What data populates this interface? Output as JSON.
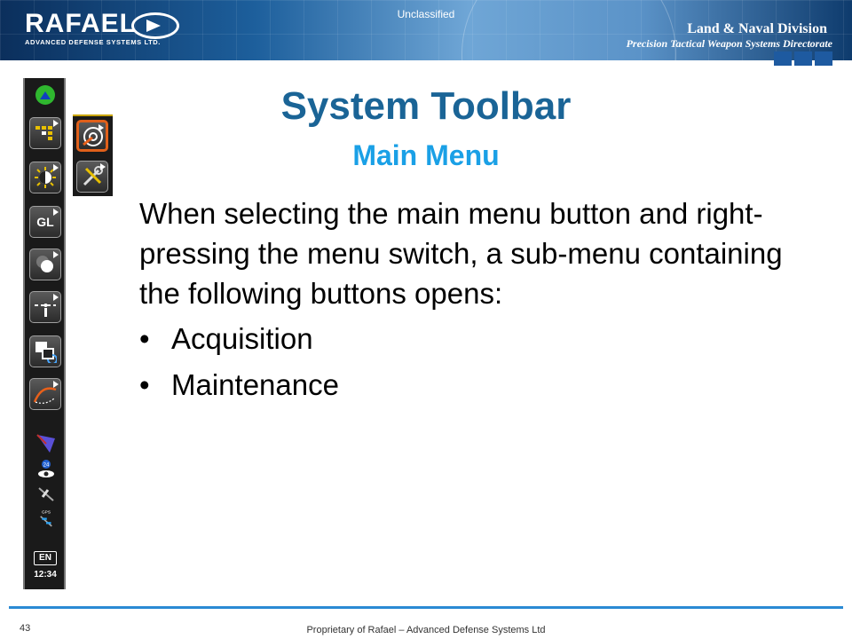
{
  "header": {
    "logo_text": "RAFAEL",
    "logo_subtitle": "ADVANCED DEFENSE SYSTEMS LTD.",
    "classification": "Unclassified",
    "division": "Land & Naval Division",
    "directorate": "Precision Tactical Weapon Systems Directorate"
  },
  "slide": {
    "title": "System Toolbar",
    "subtitle": "Main Menu",
    "body": "When selecting the main menu button and right-pressing the menu switch, a sub-menu containing the following buttons opens:",
    "bullets": [
      "Acquisition",
      "Maintenance"
    ],
    "bullet_glyph": "•"
  },
  "toolbar": {
    "buttons": [
      {
        "icon": "menu-grid-icon"
      },
      {
        "icon": "brightness-icon"
      },
      {
        "label": "GL",
        "icon": "gl-icon"
      },
      {
        "icon": "circles-icon"
      },
      {
        "icon": "crosshair-marker-icon"
      },
      {
        "icon": "window-refresh-icon"
      },
      {
        "icon": "trajectory-icon"
      }
    ],
    "status_icons": [
      "antenna-icon",
      "eye-24-icon",
      "satellite-icon",
      "gps-satellite-icon"
    ],
    "gps_label": "GPS",
    "language": "EN",
    "time": "12:34"
  },
  "submenu": {
    "buttons": [
      {
        "icon": "acquisition-target-icon",
        "active": true
      },
      {
        "icon": "maintenance-tools-icon",
        "active": false
      }
    ]
  },
  "footer": {
    "page_number": "43",
    "text": "Proprietary of Rafael – Advanced Defense Systems Ltd"
  },
  "colors": {
    "title": "#1a6496",
    "subtitle": "#1aa0e6",
    "footer_line": "#2a8ad4",
    "active_border": "#e0601a"
  }
}
